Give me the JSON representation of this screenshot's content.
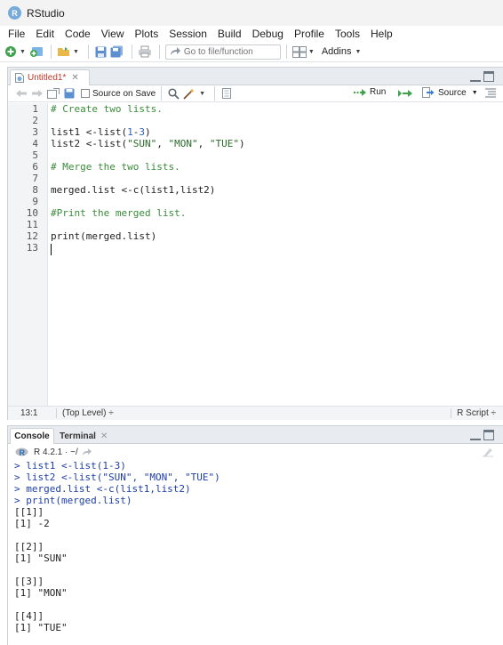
{
  "window": {
    "title": "RStudio",
    "logo_letter": "R"
  },
  "menu": [
    "File",
    "Edit",
    "Code",
    "View",
    "Plots",
    "Session",
    "Build",
    "Debug",
    "Profile",
    "Tools",
    "Help"
  ],
  "toolbar": {
    "goto_placeholder": "Go to file/function",
    "addins_label": "Addins"
  },
  "source": {
    "tab_name": "Untitled1*",
    "source_on_save": "Source on Save",
    "run_label": "Run",
    "source_label": "Source",
    "lines": [
      "# Create two lists.",
      "",
      "list1 <-list(1-3)",
      "list2 <-list(\"SUN\", \"MON\", \"TUE\")",
      "",
      "# Merge the two lists.",
      "",
      "merged.list <-c(list1,list2)",
      "",
      "#Print the merged list.",
      "",
      "print(merged.list)",
      ""
    ],
    "line_numbers": [
      "1",
      "2",
      "3",
      "4",
      "5",
      "6",
      "7",
      "8",
      "9",
      "10",
      "11",
      "12",
      "13"
    ]
  },
  "status": {
    "position": "13:1",
    "scope": "(Top Level) ÷",
    "file_type": "R Script ÷"
  },
  "console": {
    "tab_console": "Console",
    "tab_terminal": "Terminal",
    "r_version": "R 4.2.1 · ~/",
    "lines": [
      {
        "kind": "in",
        "text": "> list1 <-list(1-3)"
      },
      {
        "kind": "in",
        "text": "> list2 <-list(\"SUN\", \"MON\", \"TUE\")"
      },
      {
        "kind": "in",
        "text": "> merged.list <-c(list1,list2)"
      },
      {
        "kind": "in",
        "text": "> print(merged.list)"
      },
      {
        "kind": "out",
        "text": "[[1]]"
      },
      {
        "kind": "out",
        "text": "[1] -2"
      },
      {
        "kind": "out",
        "text": ""
      },
      {
        "kind": "out",
        "text": "[[2]]"
      },
      {
        "kind": "out",
        "text": "[1] \"SUN\""
      },
      {
        "kind": "out",
        "text": ""
      },
      {
        "kind": "out",
        "text": "[[3]]"
      },
      {
        "kind": "out",
        "text": "[1] \"MON\""
      },
      {
        "kind": "out",
        "text": ""
      },
      {
        "kind": "out",
        "text": "[[4]]"
      },
      {
        "kind": "out",
        "text": "[1] \"TUE\""
      }
    ]
  },
  "colors": {
    "comment": "#3a8c3a",
    "number": "#2f5fb3",
    "string": "#2a6b2a",
    "console_input": "#1d3ea8",
    "tab_modified": "#c0392b"
  }
}
